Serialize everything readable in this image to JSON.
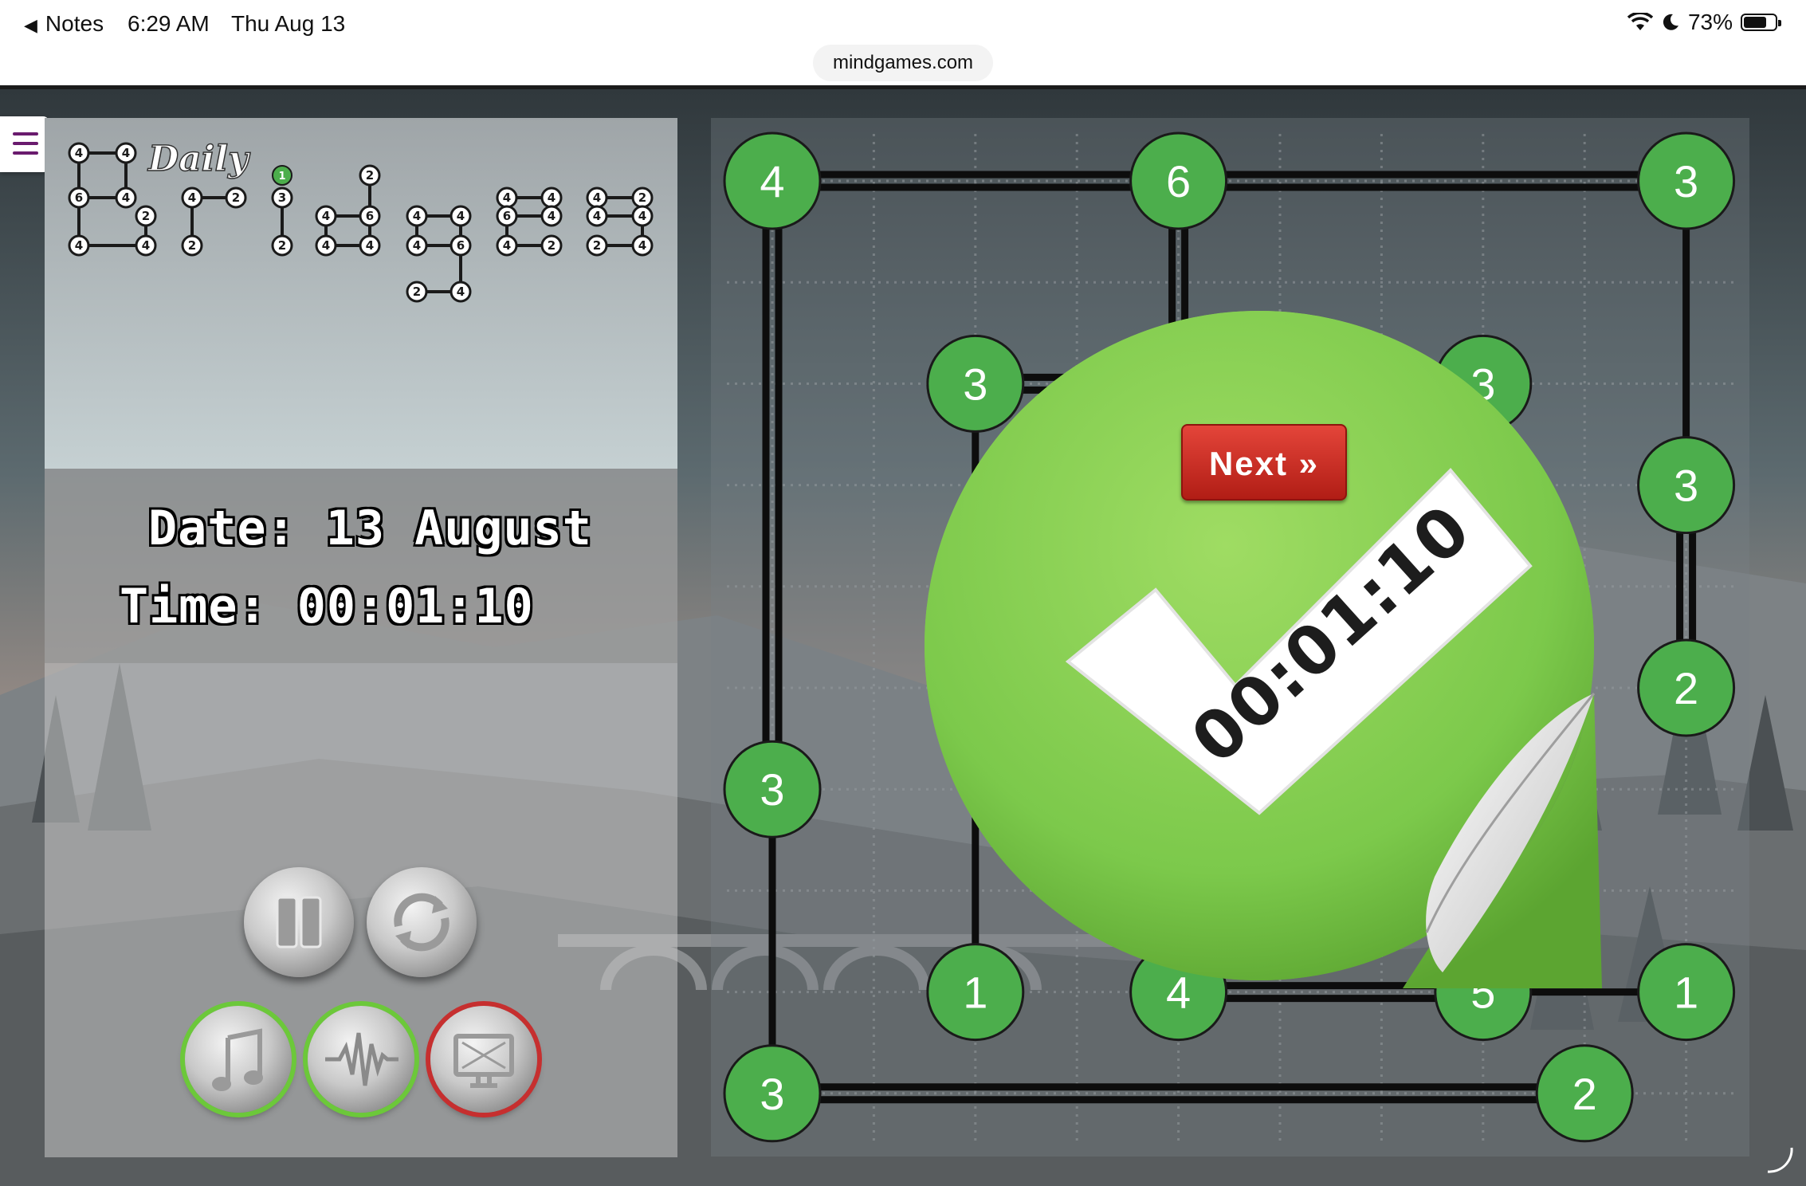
{
  "status_bar": {
    "back_label": "Notes",
    "time": "6:29 AM",
    "date": "Thu Aug 13",
    "battery": "73%",
    "battery_level": 0.73,
    "url": "mindgames.com"
  },
  "left_panel": {
    "logo_script": "Daily",
    "date_text": "Date: 13 August",
    "time_text": "Time: 00:01:10",
    "controls": [
      {
        "name": "pause-button",
        "icon": "pause-icon"
      },
      {
        "name": "restart-button",
        "icon": "restart-icon"
      },
      {
        "name": "music-toggle",
        "icon": "music-note-icon",
        "state": "on"
      },
      {
        "name": "sound-toggle",
        "icon": "sound-wave-icon",
        "state": "on"
      },
      {
        "name": "screen-toggle",
        "icon": "monitor-icon",
        "state": "off"
      }
    ]
  },
  "puzzle": {
    "islands": [
      {
        "id": "a",
        "col": 0,
        "row": 0,
        "value": "4"
      },
      {
        "id": "b",
        "col": 4,
        "row": 0,
        "value": "6"
      },
      {
        "id": "c",
        "col": 9,
        "row": 0,
        "value": "3"
      },
      {
        "id": "d",
        "col": 2,
        "row": 2,
        "value": "3"
      },
      {
        "id": "e",
        "col": 7,
        "row": 2,
        "value": "3"
      },
      {
        "id": "f",
        "col": 9,
        "row": 3,
        "value": "3"
      },
      {
        "id": "g",
        "col": 9,
        "row": 5,
        "value": "2"
      },
      {
        "id": "h",
        "col": 0,
        "row": 6,
        "value": "3"
      },
      {
        "id": "i",
        "col": 2,
        "row": 8,
        "value": "1"
      },
      {
        "id": "j",
        "col": 4,
        "row": 8,
        "value": "4"
      },
      {
        "id": "k",
        "col": 7,
        "row": 8,
        "value": "5"
      },
      {
        "id": "l",
        "col": 9,
        "row": 8,
        "value": "1"
      },
      {
        "id": "m",
        "col": 0,
        "row": 9,
        "value": "3"
      },
      {
        "id": "n",
        "col": 8,
        "row": 9,
        "value": "2"
      }
    ],
    "bridges": [
      {
        "from": "a",
        "to": "b",
        "count": 2
      },
      {
        "from": "b",
        "to": "c",
        "count": 2
      },
      {
        "from": "a",
        "to": "h",
        "count": 2
      },
      {
        "from": "h",
        "to": "m",
        "count": 1
      },
      {
        "from": "c",
        "to": "f",
        "count": 1
      },
      {
        "from": "f",
        "to": "g",
        "count": 2
      },
      {
        "from": "b",
        "to": "j",
        "count": 2
      },
      {
        "from": "d",
        "to": "e",
        "count": 2
      },
      {
        "from": "d",
        "to": "i",
        "count": 1
      },
      {
        "from": "e",
        "to": "k",
        "count": 2
      },
      {
        "from": "j",
        "to": "k",
        "count": 2
      },
      {
        "from": "k",
        "to": "l",
        "count": 1
      },
      {
        "from": "m",
        "to": "n",
        "count": 2
      }
    ]
  },
  "success": {
    "next_label": "Next »",
    "elapsed": "00:01:10"
  },
  "colors": {
    "island_green": "#4cae4c",
    "sticker_green": "#7cc94b",
    "next_red": "#d2312a"
  }
}
